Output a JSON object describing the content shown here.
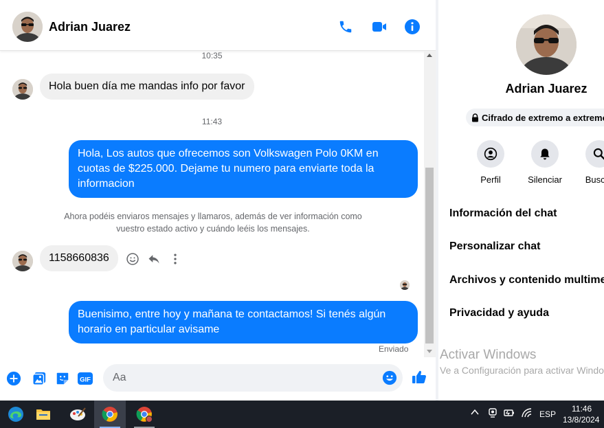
{
  "chat": {
    "contact_name": "Adrian Juarez",
    "messages": [
      {
        "type": "timestamp",
        "text": "10:35"
      },
      {
        "type": "incoming",
        "text": "Hola buen día me mandas info por favor"
      },
      {
        "type": "timestamp",
        "text": "11:43"
      },
      {
        "type": "outgoing",
        "lines": [
          "Hola, Los autos que ofrecemos son Volkswagen Polo 0KM en",
          "cuotas de $225.000. Dejame tu numero para enviarte toda la",
          "informacion"
        ]
      },
      {
        "type": "notice",
        "lines": [
          "Ahora podéis enviaros mensajes y llamaros, además de ver información como",
          "vuestro estado activo y cuándo leéis los mensajes."
        ]
      },
      {
        "type": "incoming",
        "text": "1158660836"
      },
      {
        "type": "outgoing",
        "lines": [
          "Buenisimo, entre hoy y mañana te contactamos! Si tenés algún",
          "horario en particular avisame"
        ]
      }
    ],
    "status": "Enviado",
    "composer_placeholder": "Aa",
    "header_icons": [
      "phone-icon",
      "video-camera-icon",
      "info-icon"
    ],
    "composer_icons": [
      "plus-icon",
      "image-icon",
      "sticker-icon",
      "gif-icon",
      "emoji-icon",
      "thumbs-up-icon"
    ],
    "gif_label": "GIF"
  },
  "info_panel": {
    "name": "Adrian Juarez",
    "encryption": "Cifrado de extremo a extremo",
    "actions": [
      {
        "label": "Perfil",
        "icon": "profile-icon"
      },
      {
        "label": "Silenciar",
        "icon": "bell-icon"
      },
      {
        "label": "Buscar",
        "icon": "search-icon"
      }
    ],
    "sections": [
      "Información del chat",
      "Personalizar chat",
      "Archivos y contenido multimedia",
      "Privacidad y ayuda"
    ],
    "watermark": {
      "title": "Activar Windows",
      "subtitle": "Ve a Configuración para activar Windows."
    }
  },
  "taskbar": {
    "apps": [
      "edge-icon",
      "file-explorer-icon",
      "paint-icon",
      "chrome-icon",
      "chrome-profile-icon"
    ],
    "language": "ESP",
    "time": "11:46",
    "date": "13/8/2024"
  },
  "colors": {
    "accent": "#0a7cff",
    "incoming_bubble": "#f0f0f0",
    "taskbar": "#1b1f27"
  }
}
